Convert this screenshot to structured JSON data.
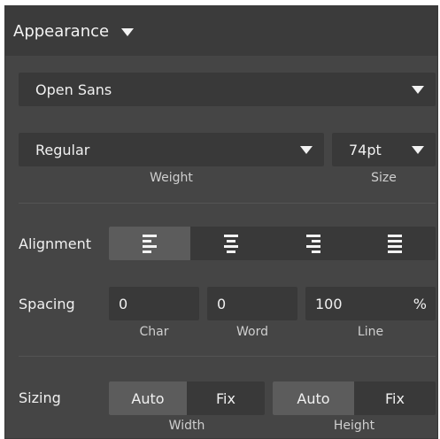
{
  "header": {
    "title": "Appearance"
  },
  "font": {
    "family": "Open Sans"
  },
  "weight": {
    "value": "Regular",
    "caption": "Weight"
  },
  "size": {
    "value": "74pt",
    "caption": "Size"
  },
  "alignment": {
    "label": "Alignment",
    "options": [
      "left-align-icon",
      "center-align-icon",
      "right-align-icon",
      "justify-align-icon"
    ],
    "selected": "left"
  },
  "spacing": {
    "label": "Spacing",
    "char": {
      "value": "0",
      "caption": "Char"
    },
    "word": {
      "value": "0",
      "caption": "Word"
    },
    "line": {
      "value": "100",
      "unit": "%",
      "caption": "Line"
    }
  },
  "sizing": {
    "label": "Sizing",
    "width": {
      "options": [
        "Auto",
        "Fix"
      ],
      "selected": "Auto",
      "caption": "Width"
    },
    "height": {
      "options": [
        "Auto",
        "Fix"
      ],
      "selected": "Auto",
      "caption": "Height"
    }
  },
  "colors": {
    "panel": "#454545",
    "field": "#393939",
    "active": "#5c5c5c",
    "text": "#f0f0f0"
  }
}
